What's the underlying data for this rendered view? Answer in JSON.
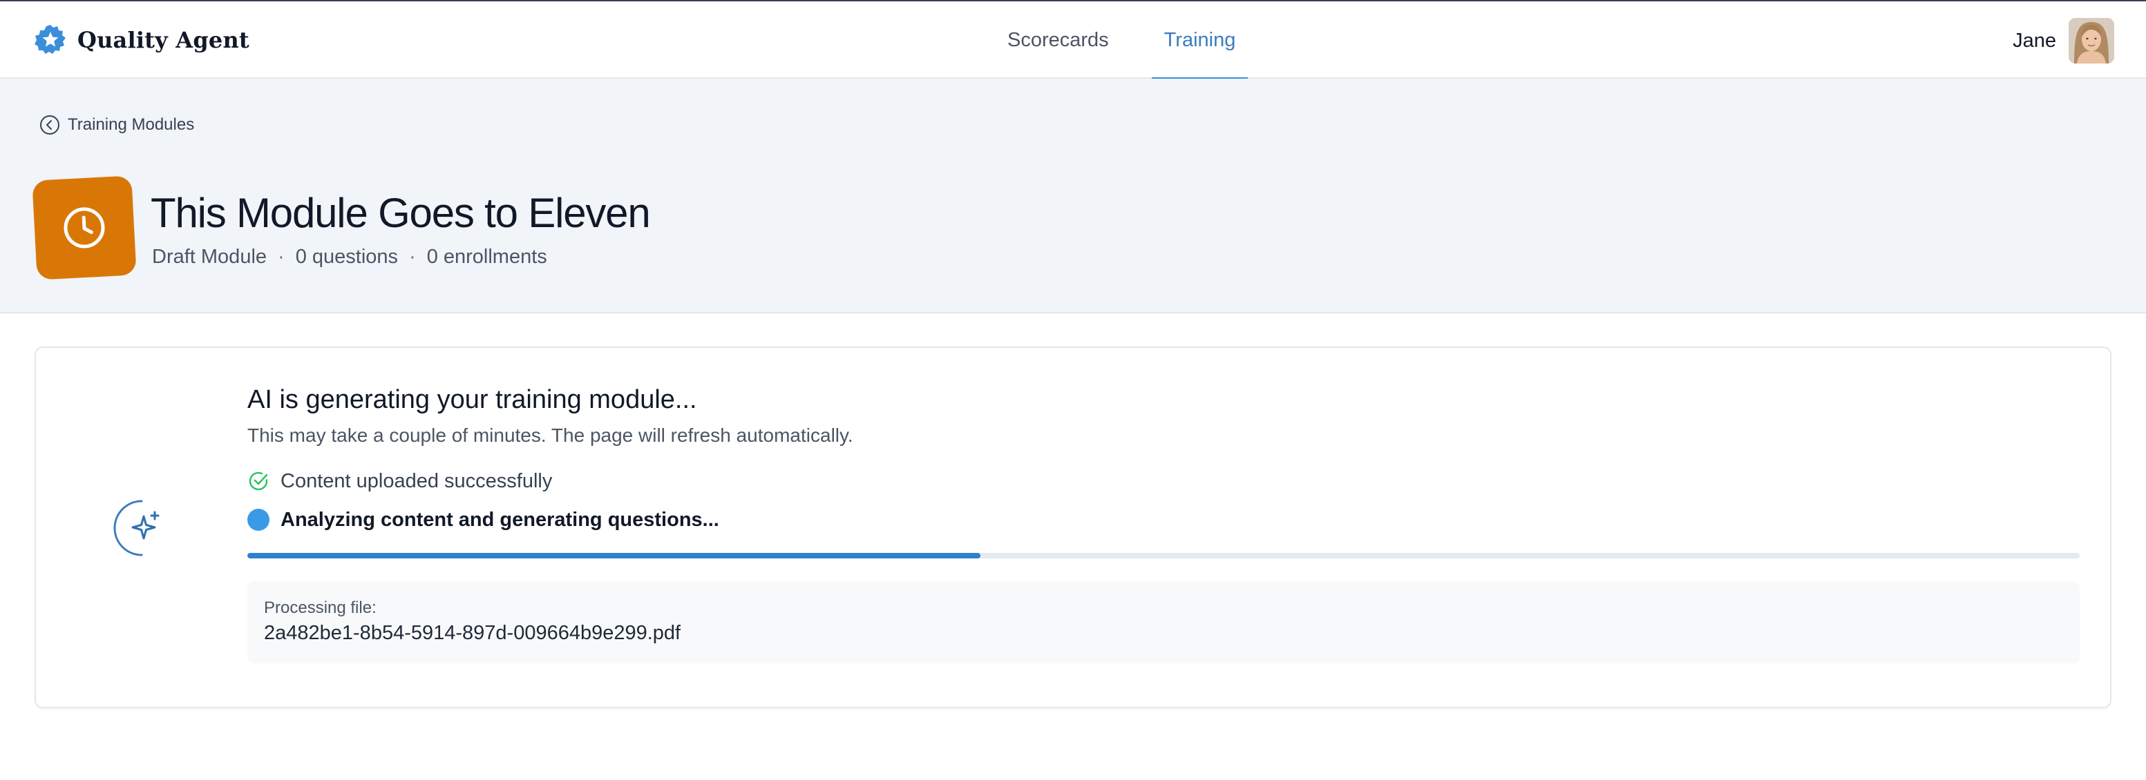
{
  "header": {
    "brand": "Quality Agent",
    "nav": [
      {
        "label": "Scorecards",
        "active": false
      },
      {
        "label": "Training",
        "active": true
      }
    ],
    "user_name": "Jane"
  },
  "banner": {
    "back_label": "Training Modules",
    "title": "This Module Goes to Eleven",
    "status": "Draft Module",
    "separator": "·",
    "questions": "0 questions",
    "enrollments": "0 enrollments",
    "icon": "clock-icon",
    "icon_bg": "#d97706"
  },
  "generation": {
    "title": "AI is generating your training module...",
    "subtitle": "This may take a couple of minutes. The page will refresh automatically.",
    "steps": [
      {
        "label": "Content uploaded successfully",
        "status": "done"
      },
      {
        "label": "Analyzing content and generating questions...",
        "status": "in-progress"
      }
    ],
    "progress_percent": 40,
    "file_label": "Processing file:",
    "file_name": "2a482be1-8b54-5914-897d-009664b9e299.pdf"
  },
  "colors": {
    "accent": "#3b8fd9",
    "progress": "#2f7fcf",
    "success": "#22c55e",
    "module": "#d97706"
  }
}
